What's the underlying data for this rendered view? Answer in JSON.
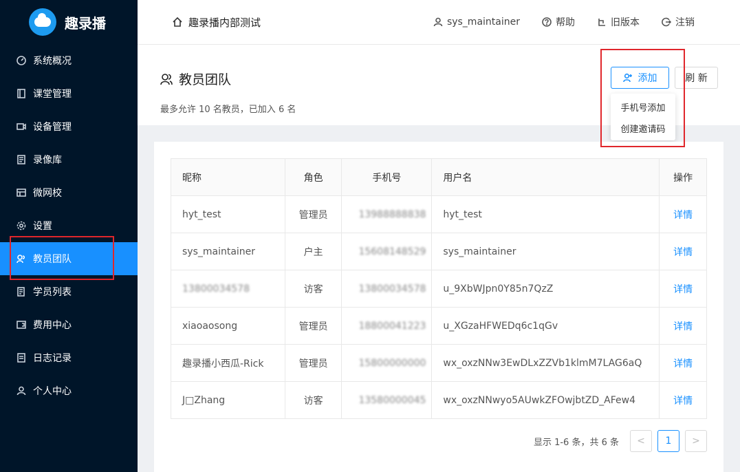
{
  "app": {
    "name": "趣录播"
  },
  "sidebar": {
    "items": [
      {
        "label": "系统概况",
        "icon": "dashboard-icon"
      },
      {
        "label": "课堂管理",
        "icon": "book-icon"
      },
      {
        "label": "设备管理",
        "icon": "device-icon"
      },
      {
        "label": "录像库",
        "icon": "library-icon"
      },
      {
        "label": "微网校",
        "icon": "school-icon"
      },
      {
        "label": "设置",
        "icon": "gear-icon"
      },
      {
        "label": "教员团队",
        "icon": "team-icon",
        "active": true
      },
      {
        "label": "学员列表",
        "icon": "student-list-icon"
      },
      {
        "label": "费用中心",
        "icon": "billing-icon"
      },
      {
        "label": "日志记录",
        "icon": "log-icon"
      },
      {
        "label": "个人中心",
        "icon": "user-icon"
      }
    ]
  },
  "header": {
    "title": "趣录播内部测试",
    "user": "sys_maintainer",
    "help": "帮助",
    "old_version": "旧版本",
    "logout": "注销"
  },
  "page": {
    "title": "教员团队",
    "subtitle": "最多允许 10 名教员，已加入 6 名",
    "add_label": "添加",
    "refresh_label": "刷 新",
    "dropdown": [
      "手机号添加",
      "创建邀请码"
    ]
  },
  "table": {
    "columns": [
      "昵称",
      "角色",
      "手机号",
      "用户名",
      "操作"
    ],
    "rows": [
      {
        "nickname": "hyt_test",
        "role": "管理员",
        "phone": "13988888838",
        "username": "hyt_test",
        "action": "详情"
      },
      {
        "nickname": "sys_maintainer",
        "role": "户主",
        "phone": "15608148529",
        "username": "sys_maintainer",
        "action": "详情"
      },
      {
        "nickname": "13800034578",
        "role": "访客",
        "phone": "13800034578",
        "username": "u_9XbWJpn0Y85n7QzZ",
        "action": "详情"
      },
      {
        "nickname": "xiaoaosong",
        "role": "管理员",
        "phone": "18800041223",
        "username": "u_XGzaHFWEDq6c1qGv",
        "action": "详情"
      },
      {
        "nickname": "趣录播小西瓜-Rick",
        "role": "管理员",
        "phone": "15800000000",
        "username": "wx_oxzNNw3EwDLxZZVb1klmM7LAG6aQ",
        "action": "详情"
      },
      {
        "nickname": "J□Zhang",
        "role": "访客",
        "phone": "13580000045",
        "username": "wx_oxzNNwyo5AUwkZFOwjbtZD_AFew4",
        "action": "详情"
      }
    ]
  },
  "pagination": {
    "total_text": "显示 1-6 条，共 6 条",
    "current": "1",
    "prev": "<",
    "next": ">"
  },
  "colors": {
    "sidebar_bg": "#001529",
    "accent": "#1890ff",
    "highlight_box": "#e0262b"
  }
}
